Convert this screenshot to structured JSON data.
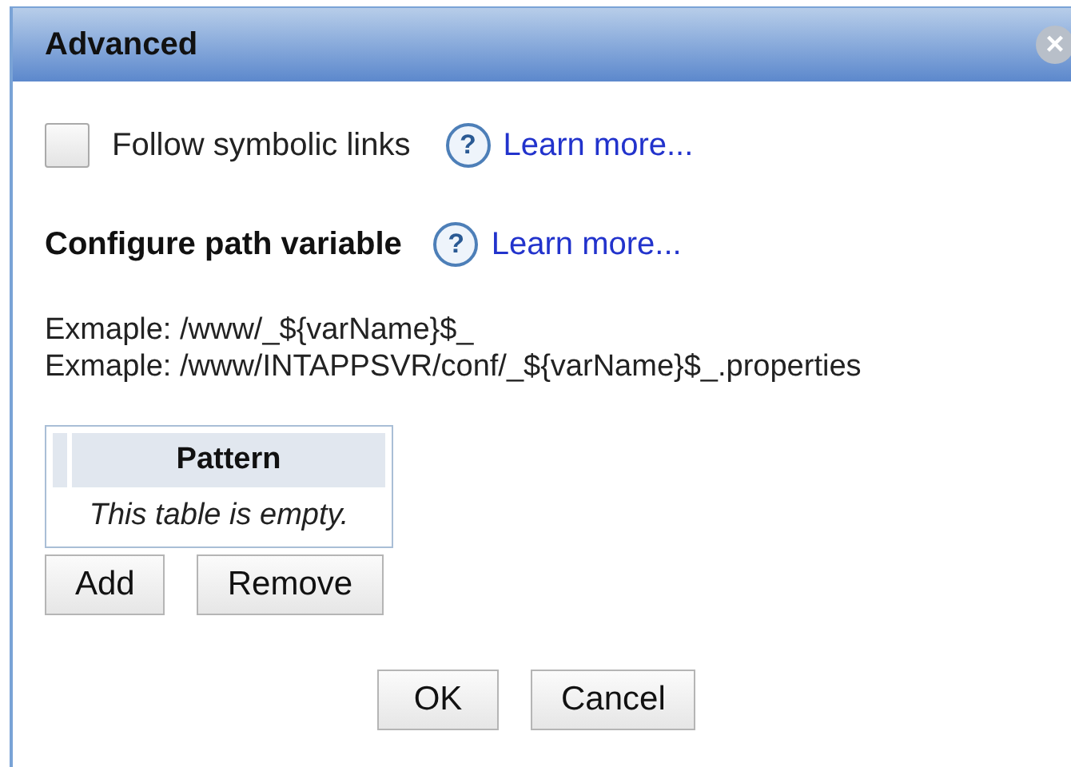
{
  "window": {
    "title": "Advanced",
    "close": "×"
  },
  "follow_links": {
    "label": "Follow symbolic links",
    "checked": false,
    "help": "?",
    "link": "Learn more..."
  },
  "path_variable": {
    "heading": "Configure path variable",
    "help": "?",
    "link": "Learn more..."
  },
  "examples": [
    "Exmaple: /www/_${varName}$_",
    "Exmaple: /www/INTAPPSVR/conf/_${varName}$_.properties"
  ],
  "table": {
    "columns": [
      "Pattern"
    ],
    "empty_text": "This table is empty."
  },
  "table_buttons": [
    "Add",
    "Remove"
  ],
  "buttons": [
    "OK",
    "Cancel"
  ]
}
